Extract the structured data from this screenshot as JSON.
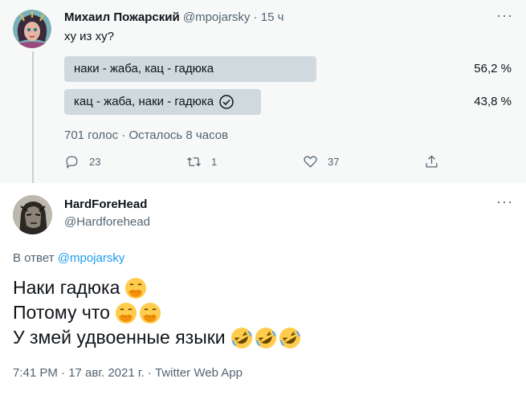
{
  "tweet1": {
    "author_name": "Михаил Пожарский",
    "author_handle": "@mpojarsky",
    "separator": "·",
    "time": "15 ч",
    "text": "ху из ху?",
    "poll": {
      "options": [
        {
          "label": "наки - жаба, кац - гадюка",
          "percent": "56,2 %",
          "share": 0.562
        },
        {
          "label": "кац - жаба, наки - гадюка",
          "percent": "43,8 %",
          "share": 0.438,
          "selected": true
        }
      ],
      "meta": "701 голос · Осталось 8 часов"
    },
    "actions": {
      "reply_count": "23",
      "retweet_count": "1",
      "like_count": "37"
    }
  },
  "tweet2": {
    "author_name": "HardForeHead",
    "author_handle": "@Hardforehead",
    "reply_prefix": "В ответ",
    "reply_to": "@mpojarsky",
    "lines": [
      "Наки гадюка",
      "Потому что",
      "У змей удвоенные языки"
    ],
    "footer": "7:41 PM · 17 авг. 2021 г. · Twitter Web App"
  },
  "icons": {
    "more": "more-icon",
    "reply": "reply-icon",
    "retweet": "retweet-icon",
    "like": "heart-icon",
    "share": "share-icon",
    "check": "check-circle-icon",
    "emoji_hand": "face-with-hand-over-mouth-icon",
    "emoji_laugh": "rolling-on-floor-laughing-icon"
  },
  "colors": {
    "link": "#1d9bf0",
    "muted": "#536471",
    "poll_bar": "#cfd9de"
  }
}
